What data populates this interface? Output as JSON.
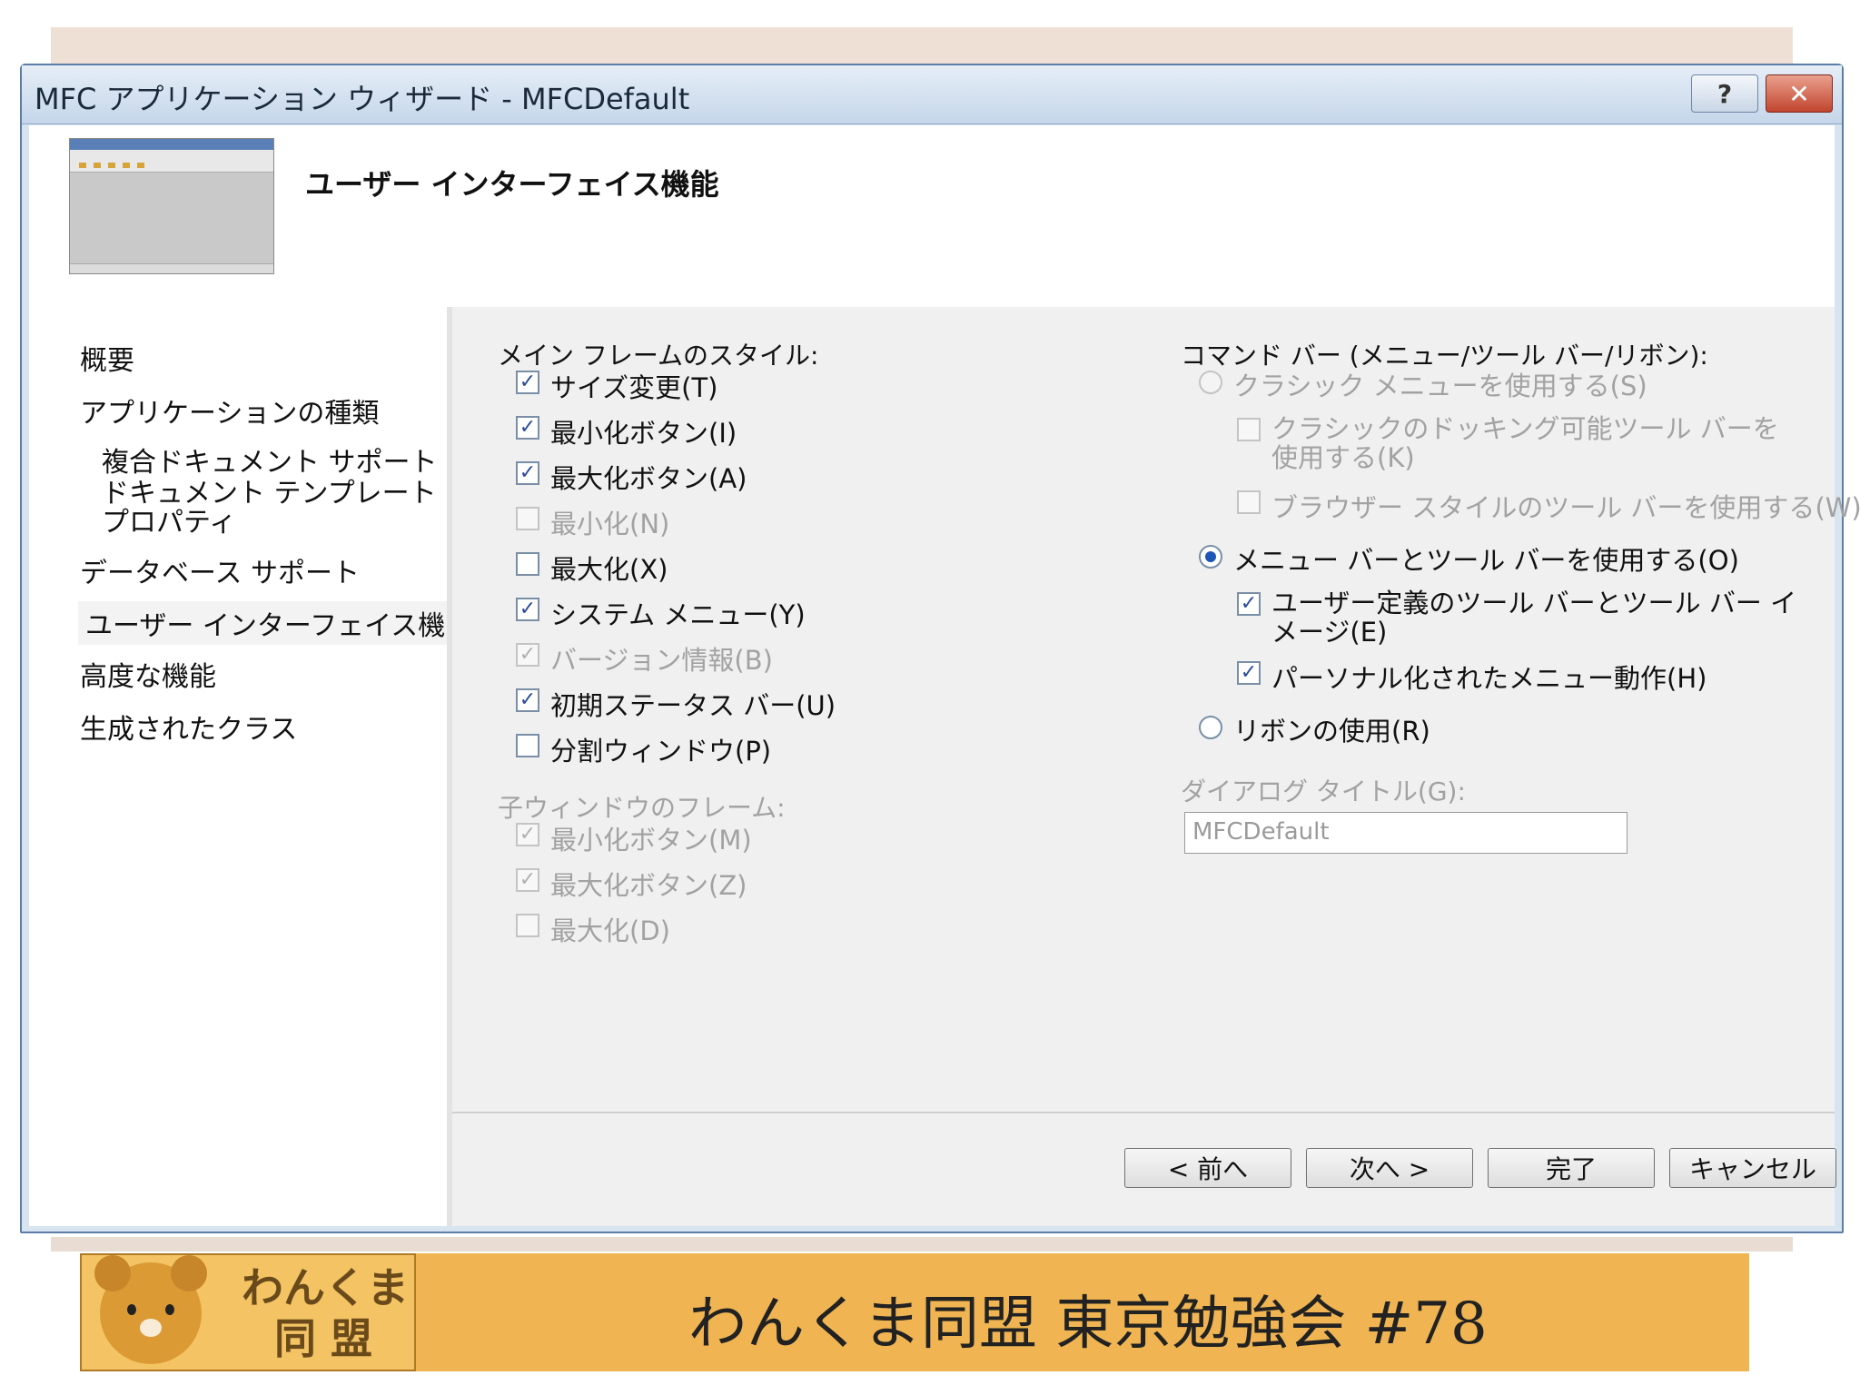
{
  "window": {
    "title": "MFC アプリケーション ウィザード - MFCDefault",
    "help_label": "?",
    "close_label": "✕"
  },
  "header": {
    "title": "ユーザー インターフェイス機能"
  },
  "nav": {
    "items": [
      {
        "label": "概要"
      },
      {
        "label": "アプリケーションの種類"
      },
      {
        "label": "複合ドキュメント サポート"
      },
      {
        "label": "ドキュメント テンプレート プロパティ"
      },
      {
        "label": "データベース サポート"
      },
      {
        "label": "ユーザー インターフェイス機能"
      },
      {
        "label": "高度な機能"
      },
      {
        "label": "生成されたクラス"
      }
    ]
  },
  "main_frame": {
    "label": "メイン フレームのスタイル:",
    "options": [
      {
        "label": "サイズ変更(T)",
        "checked": true,
        "enabled": true
      },
      {
        "label": "最小化ボタン(I)",
        "checked": true,
        "enabled": true
      },
      {
        "label": "最大化ボタン(A)",
        "checked": true,
        "enabled": true
      },
      {
        "label": "最小化(N)",
        "checked": false,
        "enabled": false
      },
      {
        "label": "最大化(X)",
        "checked": false,
        "enabled": true
      },
      {
        "label": "システム メニュー(Y)",
        "checked": true,
        "enabled": true
      },
      {
        "label": "バージョン情報(B)",
        "checked": true,
        "enabled": false
      },
      {
        "label": "初期ステータス バー(U)",
        "checked": true,
        "enabled": true
      },
      {
        "label": "分割ウィンドウ(P)",
        "checked": false,
        "enabled": true
      }
    ]
  },
  "child_frame": {
    "label": "子ウィンドウのフレーム:",
    "options": [
      {
        "label": "最小化ボタン(M)",
        "checked": true,
        "enabled": false
      },
      {
        "label": "最大化ボタン(Z)",
        "checked": true,
        "enabled": false
      },
      {
        "label": "最大化(D)",
        "checked": false,
        "enabled": false
      }
    ]
  },
  "command_bar": {
    "label": "コマンド バー (メニュー/ツール バー/リボン):",
    "classic_menu": "クラシック メニューを使用する(S)",
    "classic_docking": "クラシックのドッキング可能ツール バーを使用する(K)",
    "browser_style": "ブラウザー スタイルのツール バーを使用する(W)",
    "menubar_toolbar": "メニュー バーとツール バーを使用する(O)",
    "user_defined": "ユーザー定義のツール バーとツール バー イメージ(E)",
    "personalized": "パーソナル化されたメニュー動作(H)",
    "ribbon": "リボンの使用(R)"
  },
  "dialog_title": {
    "label": "ダイアログ タイトル(G):",
    "value": "MFCDefault"
  },
  "buttons": {
    "prev": "< 前へ",
    "next": "次へ >",
    "finish": "完了",
    "cancel": "キャンセル"
  },
  "footer": {
    "logo_line1": "わんくま",
    "logo_line2": "同 盟",
    "title": "わんくま同盟 東京勉強会 #78"
  },
  "colors": {
    "accent": "#1f55b5",
    "footer_bg": "#f0b552",
    "titlebar": "#c5d6ea"
  }
}
